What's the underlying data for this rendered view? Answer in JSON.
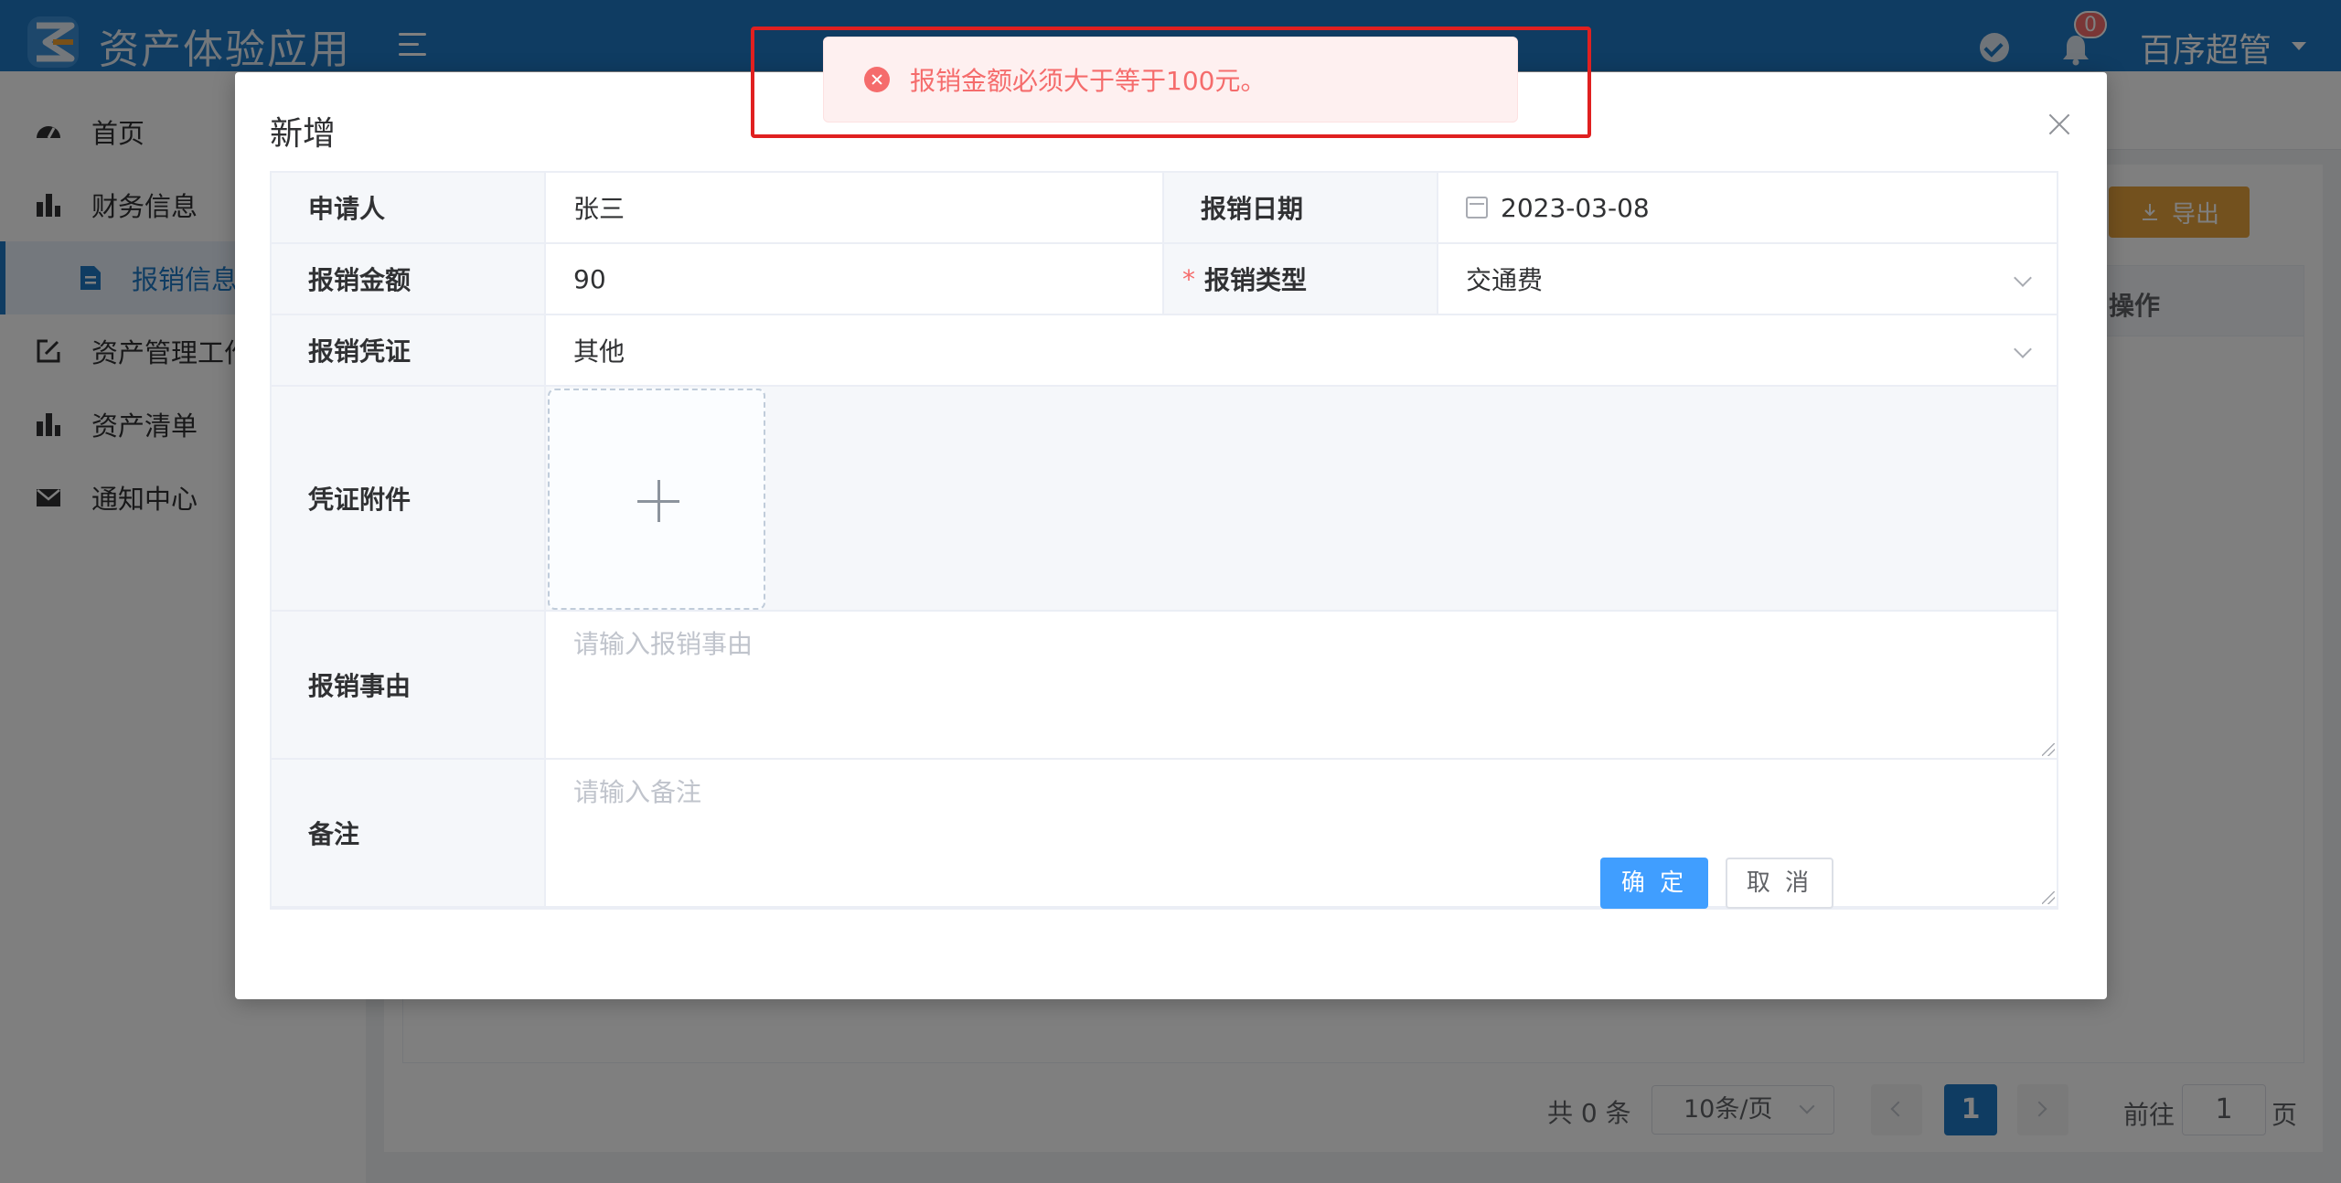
{
  "app": {
    "title": "资产体验应用"
  },
  "header": {
    "notification_count": "0",
    "user_name": "百序超管"
  },
  "sidebar": {
    "items": [
      {
        "label": "首页",
        "icon": "dashboard-icon"
      },
      {
        "label": "财务信息",
        "icon": "bar-chart-icon"
      },
      {
        "label": "报销信息",
        "icon": "document-icon",
        "active": true
      },
      {
        "label": "资产管理工作台",
        "icon": "edit-icon"
      },
      {
        "label": "资产清单",
        "icon": "bar-chart-icon"
      },
      {
        "label": "通知中心",
        "icon": "mail-icon"
      }
    ]
  },
  "main": {
    "export_label": "导出",
    "table_columns": [
      "操作"
    ],
    "pagination": {
      "total": "共 0 条",
      "page_size": "10条/页",
      "current_page": "1",
      "goto_label": "前往",
      "goto_value": "1",
      "page_suffix": "页"
    }
  },
  "dialog": {
    "title": "新增",
    "fields": {
      "applicant_label": "申请人",
      "applicant_value": "张三",
      "date_label": "报销日期",
      "date_value": "2023-03-08",
      "amount_label": "报销金额",
      "amount_value": "90",
      "type_label": "报销类型",
      "type_value": "交通费",
      "voucher_label": "报销凭证",
      "voucher_value": "其他",
      "attachment_label": "凭证附件",
      "reason_label": "报销事由",
      "reason_placeholder": "请输入报销事由",
      "remark_label": "备注",
      "remark_placeholder": "请输入备注"
    },
    "confirm_label": "确 定",
    "cancel_label": "取 消"
  },
  "toast": {
    "message": "报销金额必须大于等于100元。",
    "type": "error"
  },
  "colors": {
    "primary": "#1f79c4",
    "error": "#f56c6c",
    "warning": "#e6a23c",
    "confirm": "#409eff"
  }
}
